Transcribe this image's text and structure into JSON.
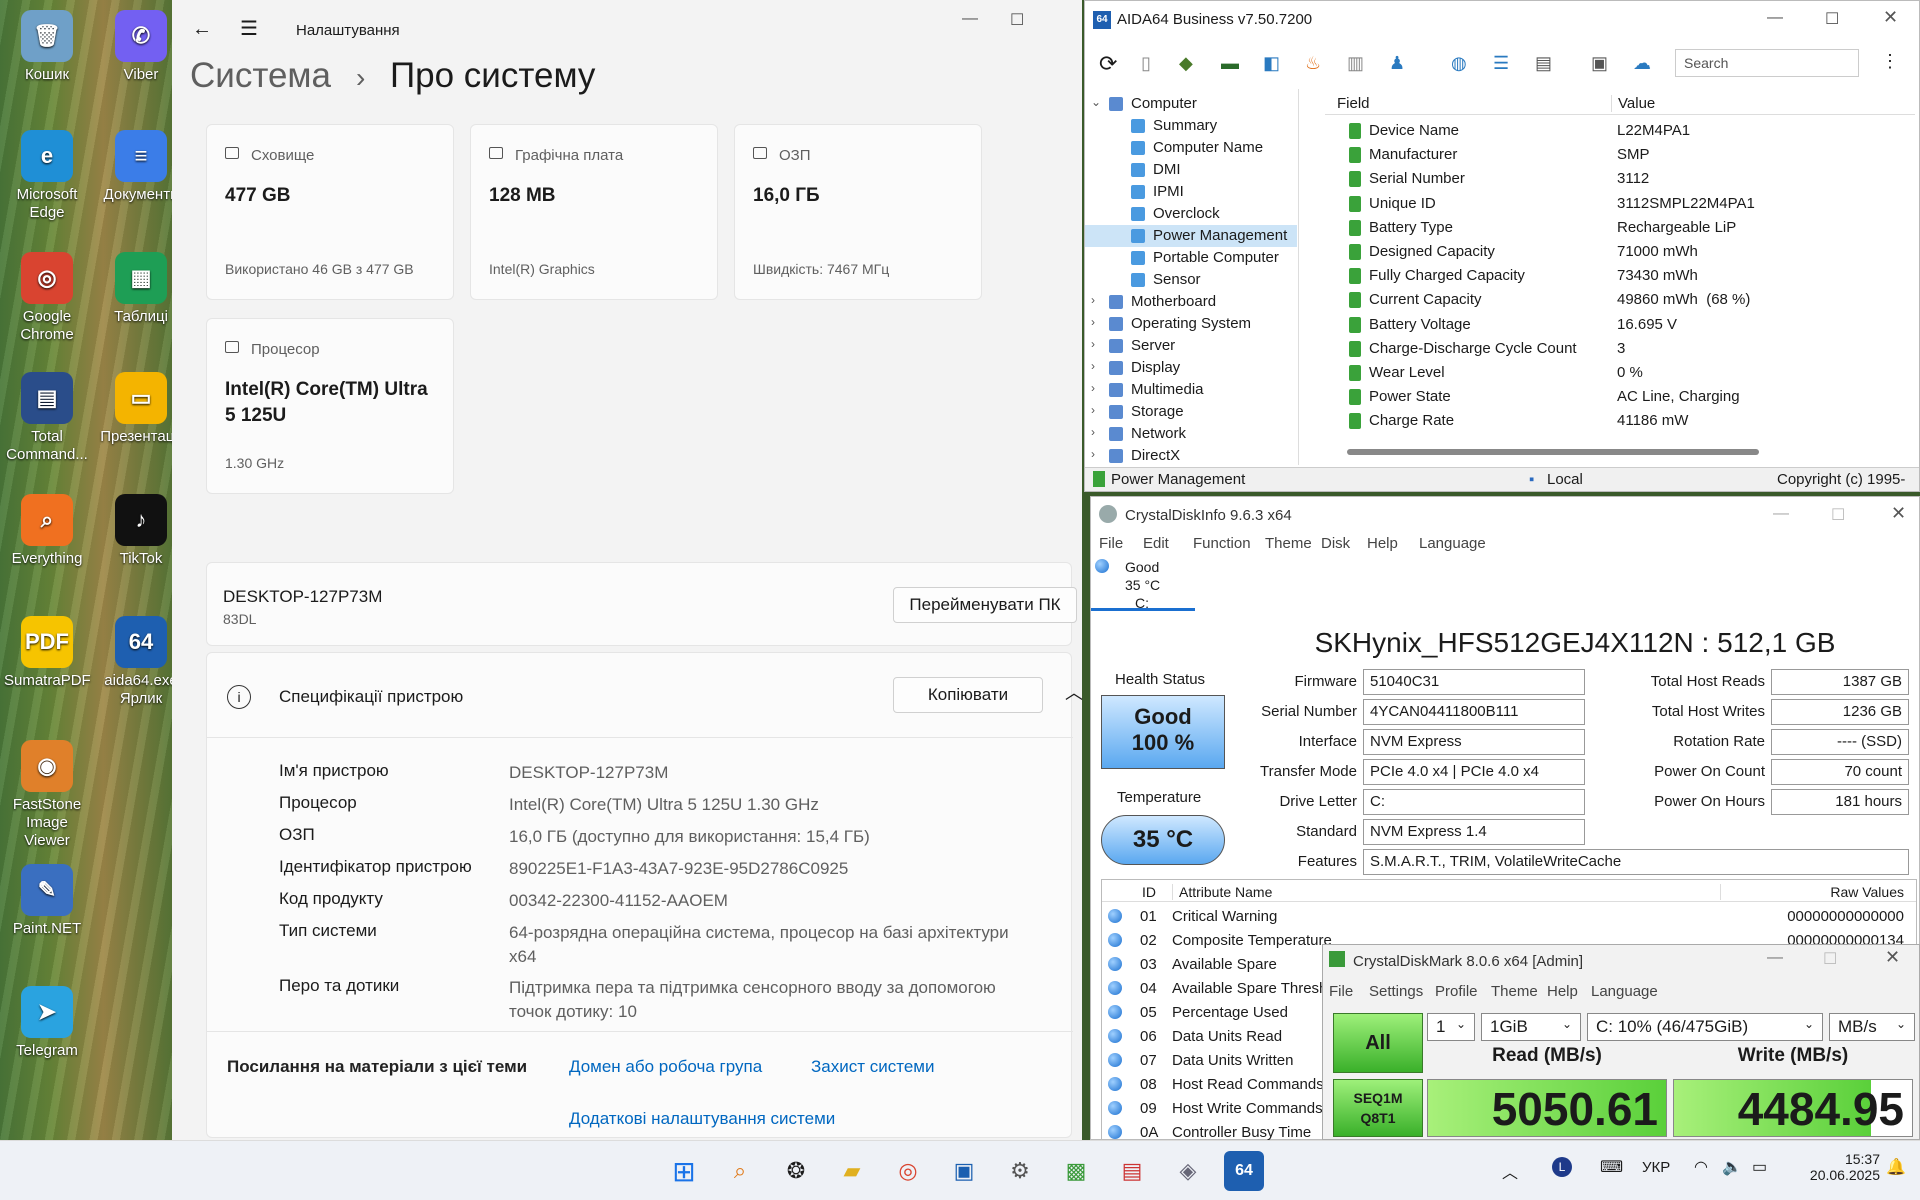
{
  "desktop": {
    "icons": [
      {
        "label": "Кошик",
        "glyph": "🗑",
        "color": "#6fa0c8"
      },
      {
        "label": "Viber",
        "glyph": "✆",
        "color": "#7360f2"
      },
      {
        "label": "Microsoft Edge",
        "glyph": "e",
        "color": "#1f8fd6"
      },
      {
        "label": "Документи",
        "glyph": "≡",
        "color": "#3b7de8"
      },
      {
        "label": "Google Chrome",
        "glyph": "◎",
        "color": "#d94430"
      },
      {
        "label": "Таблиці",
        "glyph": "▦",
        "color": "#1e9e55"
      },
      {
        "label": "Total Command...",
        "glyph": "▤",
        "color": "#2a4d8a"
      },
      {
        "label": "Презентації",
        "glyph": "▭",
        "color": "#f4b400"
      },
      {
        "label": "Everything",
        "glyph": "⌕",
        "color": "#f07020"
      },
      {
        "label": "TikTok",
        "glyph": "♪",
        "color": "#111111"
      },
      {
        "label": "SumatraPDF",
        "glyph": "PDF",
        "color": "#f6c400"
      },
      {
        "label": "aida64.exe Ярлик",
        "glyph": "64",
        "color": "#1e5fb0"
      },
      {
        "label": "FastStone Image Viewer",
        "glyph": "◉",
        "color": "#e0802a"
      },
      {
        "label": "Paint.NET",
        "glyph": "✎",
        "color": "#3a6fc0"
      },
      {
        "label": "Telegram",
        "glyph": "➤",
        "color": "#2aa3e0"
      }
    ]
  },
  "settings": {
    "app_title": "Налаштування",
    "breadcrumb_parent": "Система",
    "breadcrumb_sep": "›",
    "page_title": "Про систему",
    "cards": [
      {
        "title": "Сховище",
        "value": "477 GB",
        "sub": "Використано 46 GB з 477 GB",
        "icon": "storage-icon"
      },
      {
        "title": "Графічна плата",
        "value": "128 MB",
        "sub": "Intel(R) Graphics",
        "icon": "gpu-icon"
      },
      {
        "title": "ОЗП",
        "value": "16,0 ГБ",
        "sub": "Швидкість: 7467 МГц",
        "icon": "ram-icon"
      },
      {
        "title": "Процесор",
        "value": "Intel(R) Core(TM) Ultra 5 125U",
        "sub": "1.30 GHz",
        "icon": "cpu-icon"
      }
    ],
    "device_name": "DESKTOP-127P73M",
    "device_model": "83DL",
    "rename_button": "Перейменувати ПК",
    "specs_title": "Специфікації пристрою",
    "copy_button": "Копіювати",
    "specs": [
      {
        "k": "Ім'я пристрою",
        "v": "DESKTOP-127P73M"
      },
      {
        "k": "Процесор",
        "v": "Intel(R) Core(TM) Ultra 5 125U   1.30 GHz"
      },
      {
        "k": "ОЗП",
        "v": "16,0 ГБ (доступно для використання: 15,4 ГБ)"
      },
      {
        "k": "Ідентифікатор пристрою",
        "v": "890225E1-F1A3-43A7-923E-95D2786C0925"
      },
      {
        "k": "Код продукту",
        "v": "00342-22300-41152-AAOEM"
      },
      {
        "k": "Тип системи",
        "v": "64-розрядна операційна система, процесор на базі архітектури x64"
      },
      {
        "k": "Перо та дотики",
        "v": "Підтримка пера та підтримка сенсорного вводу за допомогою точок дотику: 10"
      }
    ],
    "related_label": "Посилання на матеріали з цієї теми",
    "links": [
      "Домен або робоча група",
      "Захист системи",
      "Додаткові налаштування системи"
    ]
  },
  "aida": {
    "title": "AIDA64 Business v7.50.7200",
    "search_placeholder": "Search",
    "tree": [
      {
        "label": "Computer",
        "level": 0,
        "expanded": true
      },
      {
        "label": "Summary",
        "level": 1
      },
      {
        "label": "Computer Name",
        "level": 1
      },
      {
        "label": "DMI",
        "level": 1
      },
      {
        "label": "IPMI",
        "level": 1
      },
      {
        "label": "Overclock",
        "level": 1
      },
      {
        "label": "Power Management",
        "level": 1,
        "selected": true
      },
      {
        "label": "Portable Computer",
        "level": 1
      },
      {
        "label": "Sensor",
        "level": 1
      },
      {
        "label": "Motherboard",
        "level": 0
      },
      {
        "label": "Operating System",
        "level": 0
      },
      {
        "label": "Server",
        "level": 0
      },
      {
        "label": "Display",
        "level": 0
      },
      {
        "label": "Multimedia",
        "level": 0
      },
      {
        "label": "Storage",
        "level": 0
      },
      {
        "label": "Network",
        "level": 0
      },
      {
        "label": "DirectX",
        "level": 0
      }
    ],
    "col_field": "Field",
    "col_value": "Value",
    "rows": [
      {
        "f": "Device Name",
        "v": "L22M4PA1"
      },
      {
        "f": "Manufacturer",
        "v": "SMP"
      },
      {
        "f": "Serial Number",
        "v": "3112"
      },
      {
        "f": "Unique ID",
        "v": "3112SMPL22M4PA1"
      },
      {
        "f": "Battery Type",
        "v": "Rechargeable LiP"
      },
      {
        "f": "Designed Capacity",
        "v": "71000 mWh"
      },
      {
        "f": "Fully Charged Capacity",
        "v": "73430 mWh"
      },
      {
        "f": "Current Capacity",
        "v": "49860 mWh  (68 %)"
      },
      {
        "f": "Battery Voltage",
        "v": "16.695 V"
      },
      {
        "f": "Charge-Discharge Cycle Count",
        "v": "3"
      },
      {
        "f": "Wear Level",
        "v": "0 %"
      },
      {
        "f": "Power State",
        "v": "AC Line, Charging"
      },
      {
        "f": "Charge Rate",
        "v": "41186 mW"
      }
    ],
    "status_left": "Power Management",
    "status_mid": "Local",
    "status_right": "Copyright (c) 1995-"
  },
  "cdi": {
    "title": "CrystalDiskInfo 9.6.3 x64",
    "menu": [
      "File",
      "Edit",
      "Function",
      "Theme",
      "Disk",
      "Help",
      "Language"
    ],
    "tab_status": "Good",
    "tab_temp": "35 °C",
    "tab_drive": "C:",
    "drive_title": "SKHynix_HFS512GEJ4X112N : 512,1 GB",
    "health_label": "Health Status",
    "health_value": "Good",
    "health_pct": "100 %",
    "temp_label": "Temperature",
    "temp_value": "35 °C",
    "left_fields": [
      {
        "k": "Firmware",
        "v": "51040C31"
      },
      {
        "k": "Serial Number",
        "v": "4YCAN04411800B111"
      },
      {
        "k": "Interface",
        "v": "NVM Express"
      },
      {
        "k": "Transfer Mode",
        "v": "PCIe 4.0 x4 | PCIe 4.0 x4"
      },
      {
        "k": "Drive Letter",
        "v": "C:"
      },
      {
        "k": "Standard",
        "v": "NVM Express 1.4"
      },
      {
        "k": "Features",
        "v": "S.M.A.R.T., TRIM, VolatileWriteCache"
      }
    ],
    "right_fields": [
      {
        "k": "Total Host Reads",
        "v": "1387 GB"
      },
      {
        "k": "Total Host Writes",
        "v": "1236 GB"
      },
      {
        "k": "Rotation Rate",
        "v": "---- (SSD)"
      },
      {
        "k": "Power On Count",
        "v": "70 count"
      },
      {
        "k": "Power On Hours",
        "v": "181 hours"
      }
    ],
    "attr_head": {
      "id": "ID",
      "name": "Attribute Name",
      "raw": "Raw Values"
    },
    "attrs": [
      {
        "id": "01",
        "name": "Critical Warning",
        "raw": "00000000000000"
      },
      {
        "id": "02",
        "name": "Composite Temperature",
        "raw": "00000000000134"
      },
      {
        "id": "03",
        "name": "Available Spare",
        "raw": ""
      },
      {
        "id": "04",
        "name": "Available Spare Threshold",
        "raw": ""
      },
      {
        "id": "05",
        "name": "Percentage Used",
        "raw": ""
      },
      {
        "id": "06",
        "name": "Data Units Read",
        "raw": ""
      },
      {
        "id": "07",
        "name": "Data Units Written",
        "raw": ""
      },
      {
        "id": "08",
        "name": "Host Read Commands",
        "raw": ""
      },
      {
        "id": "09",
        "name": "Host Write Commands",
        "raw": ""
      },
      {
        "id": "0A",
        "name": "Controller Busy Time",
        "raw": ""
      }
    ]
  },
  "cdm": {
    "title": "CrystalDiskMark 8.0.6 x64 [Admin]",
    "menu": [
      "File",
      "Settings",
      "Profile",
      "Theme",
      "Help",
      "Language"
    ],
    "all_button": "All",
    "count": "1",
    "size": "1GiB",
    "drive": "C: 10% (46/475GiB)",
    "unit": "MB/s",
    "read_head": "Read (MB/s)",
    "write_head": "Write (MB/s)",
    "test_line1": "SEQ1M",
    "test_line2": "Q8T1",
    "read_value": "5050.61",
    "write_value": "4484.95"
  },
  "taskbar": {
    "lang": "УКР",
    "time": "15:37",
    "date": "20.06.2025"
  }
}
